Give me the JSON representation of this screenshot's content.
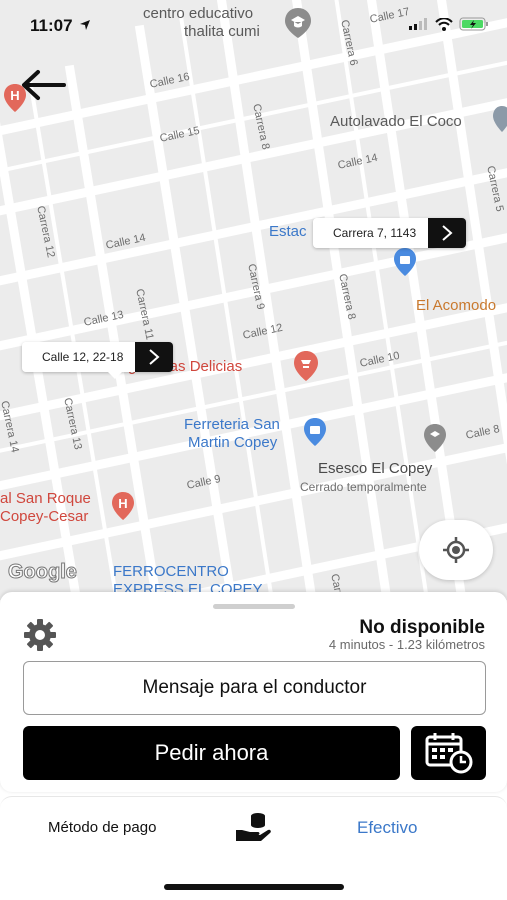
{
  "status_bar": {
    "time": "11:07"
  },
  "map": {
    "streets": [
      "Calle 17",
      "Calle 16",
      "Calle 15",
      "Calle 14",
      "Calle 14",
      "Calle 13",
      "Calle 12",
      "Calle 10",
      "Calle 9",
      "Calle 8",
      "Carrera 6",
      "Carrera 5",
      "Carrera 8",
      "Carrera 8",
      "Carrera 9",
      "Carrera 11",
      "Carrera 12",
      "Carrera 13",
      "Carrera 14",
      "Carrera 7",
      "Carrera"
    ],
    "pois": {
      "centro_line1": "centro educativo",
      "centro_line2": "thalita cumi",
      "autolavado": "Autolavado El Coco",
      "estac": "Estac",
      "acomodo": "El Acomodo",
      "delicias": "Las Delicias",
      "delicias_prefix": "g",
      "ferreteria_line1": "Ferreteria San",
      "ferreteria_line2": "Martin Copey",
      "esesco": "Esesco El Copey",
      "esesco_status": "Cerrado temporalmente",
      "san_roque_line1": "al San Roque",
      "san_roque_line2": "Copey-Cesar",
      "ferrocentro_line1": "FERROCENTRO",
      "ferrocentro_line2": "EXPRESS EL COPEY"
    },
    "callouts": {
      "destination": "Carrera 7, 1143",
      "origin": "Calle 12, 22-18"
    },
    "logo": "Google"
  },
  "sheet": {
    "availability": "No disponible",
    "eta": "4 minutos - 1.23 kilómetros",
    "message_button": "Mensaje para el conductor",
    "order_button": "Pedir ahora"
  },
  "payment": {
    "label": "Método de pago",
    "value": "Efectivo"
  },
  "colors": {
    "accent_blue": "#3b78c9",
    "map_bg": "#ececec",
    "poi_red": "#d0473d"
  },
  "icons": [
    "back-arrow-icon",
    "gear-icon",
    "locate-icon",
    "calendar-clock-icon",
    "cash-hand-icon",
    "chevron-right-icon"
  ]
}
